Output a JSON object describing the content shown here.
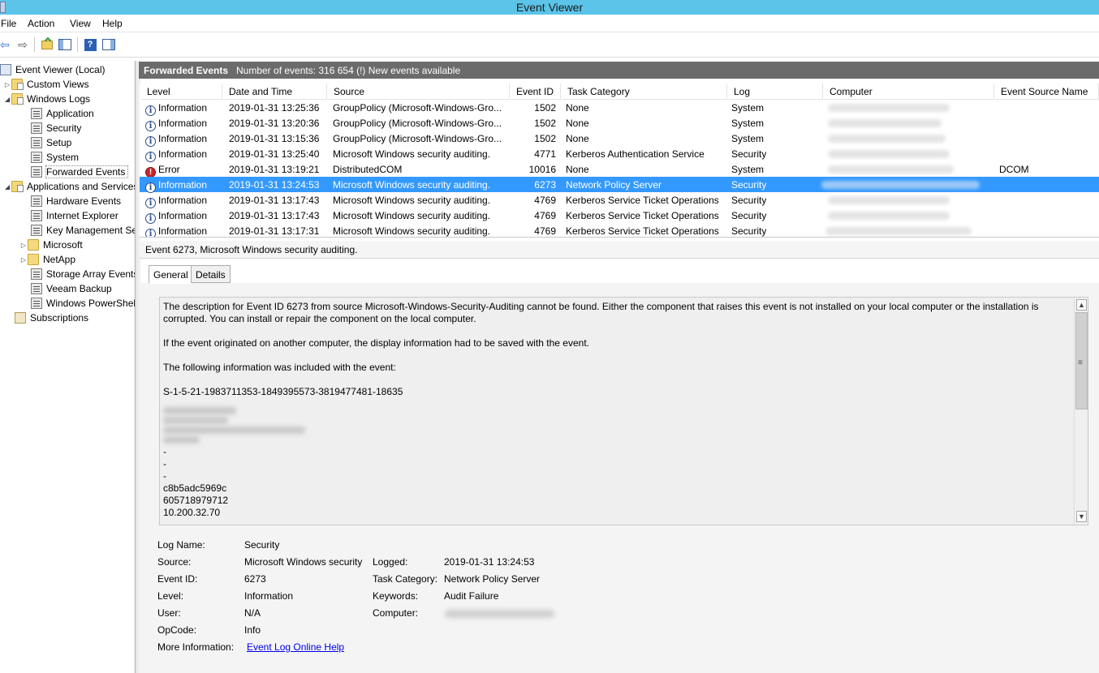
{
  "window": {
    "title": "Event Viewer"
  },
  "menu": [
    "File",
    "Action",
    "View",
    "Help"
  ],
  "tree": {
    "root": "Event Viewer (Local)",
    "custom_views": "Custom Views",
    "windows_logs": "Windows Logs",
    "windows_logs_items": [
      "Application",
      "Security",
      "Setup",
      "System",
      "Forwarded Events"
    ],
    "apps_services": "Applications and Services Logs",
    "apps_items": [
      "Hardware Events",
      "Internet Explorer",
      "Key Management Service",
      "Microsoft",
      "NetApp",
      "Storage Array Events",
      "Veeam Backup",
      "Windows PowerShell"
    ],
    "subscriptions": "Subscriptions"
  },
  "events_header": {
    "title": "Forwarded Events",
    "count": "Number of events: 316 654 (!) New events available"
  },
  "columns": [
    "Level",
    "Date and Time",
    "Source",
    "Event ID",
    "Task Category",
    "Log",
    "Computer",
    "Event Source Name"
  ],
  "rows": [
    {
      "level": "Information",
      "type": "info",
      "datetime": "2019-01-31 13:25:36",
      "source": "GroupPolicy (Microsoft-Windows-Gro...",
      "event_id": "1502",
      "task": "None",
      "log": "System",
      "esn": ""
    },
    {
      "level": "Information",
      "type": "info",
      "datetime": "2019-01-31 13:20:36",
      "source": "GroupPolicy (Microsoft-Windows-Gro...",
      "event_id": "1502",
      "task": "None",
      "log": "System",
      "esn": ""
    },
    {
      "level": "Information",
      "type": "info",
      "datetime": "2019-01-31 13:15:36",
      "source": "GroupPolicy (Microsoft-Windows-Gro...",
      "event_id": "1502",
      "task": "None",
      "log": "System",
      "esn": ""
    },
    {
      "level": "Information",
      "type": "info",
      "datetime": "2019-01-31 13:25:40",
      "source": "Microsoft Windows security auditing.",
      "event_id": "4771",
      "task": "Kerberos Authentication Service",
      "log": "Security",
      "esn": ""
    },
    {
      "level": "Error",
      "type": "error",
      "datetime": "2019-01-31 13:19:21",
      "source": "DistributedCOM",
      "event_id": "10016",
      "task": "None",
      "log": "System",
      "esn": "DCOM"
    },
    {
      "level": "Information",
      "type": "info",
      "datetime": "2019-01-31 13:24:53",
      "source": "Microsoft Windows security auditing.",
      "event_id": "6273",
      "task": "Network Policy Server",
      "log": "Security",
      "esn": "",
      "selected": true
    },
    {
      "level": "Information",
      "type": "info",
      "datetime": "2019-01-31 13:17:43",
      "source": "Microsoft Windows security auditing.",
      "event_id": "4769",
      "task": "Kerberos Service Ticket Operations",
      "log": "Security",
      "esn": ""
    },
    {
      "level": "Information",
      "type": "info",
      "datetime": "2019-01-31 13:17:43",
      "source": "Microsoft Windows security auditing.",
      "event_id": "4769",
      "task": "Kerberos Service Ticket Operations",
      "log": "Security",
      "esn": ""
    },
    {
      "level": "Information",
      "type": "info",
      "datetime": "2019-01-31 13:17:31",
      "source": "Microsoft Windows security auditing.",
      "event_id": "4769",
      "task": "Kerberos Service Ticket Operations",
      "log": "Security",
      "esn": ""
    }
  ],
  "detail": {
    "title": "Event 6273, Microsoft Windows security auditing.",
    "tabs": [
      "General",
      "Details"
    ],
    "description": {
      "p1": "The description for Event ID 6273 from source Microsoft-Windows-Security-Auditing cannot be found. Either the component that raises this event is not installed on your local computer or the installation is corrupted. You can install or repair the component on the local computer.",
      "p2": "If the event originated on another computer, the display information had to be saved with the event.",
      "p3": "The following information was included with the event:",
      "sid": "S-1-5-21-1983711353-1849395573-3819477481-18635",
      "dashes": [
        "-",
        "-",
        "-"
      ],
      "tail": [
        "c8b5adc5969c",
        "605718979712",
        "10.200.32.70"
      ]
    },
    "props": {
      "log_name_label": "Log Name:",
      "log_name": "Security",
      "source_label": "Source:",
      "source": "Microsoft Windows security",
      "logged_label": "Logged:",
      "logged": "2019-01-31 13:24:53",
      "event_id_label": "Event ID:",
      "event_id": "6273",
      "task_label": "Task Category:",
      "task": "Network Policy Server",
      "level_label": "Level:",
      "level": "Information",
      "keywords_label": "Keywords:",
      "keywords": "Audit Failure",
      "user_label": "User:",
      "user": "N/A",
      "computer_label": "Computer:",
      "opcode_label": "OpCode:",
      "opcode": "Info",
      "more_info_label": "More Information:",
      "more_info_link": "Event Log Online Help"
    }
  }
}
